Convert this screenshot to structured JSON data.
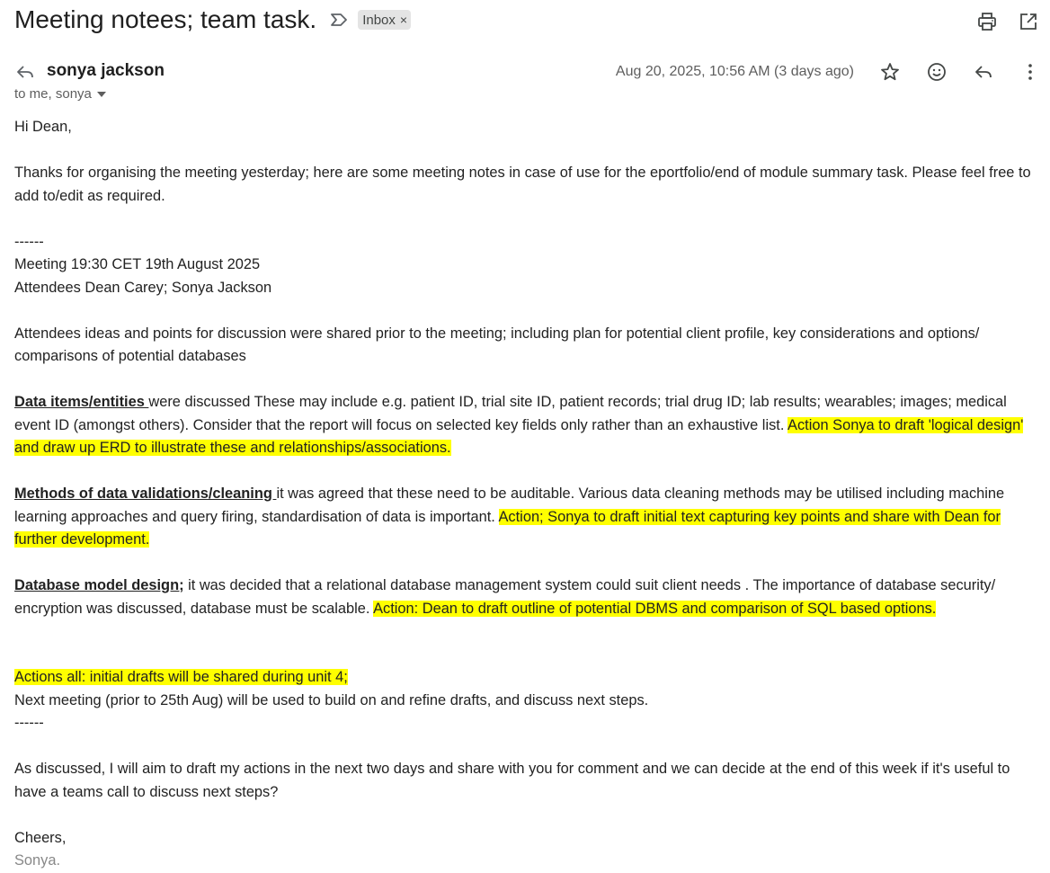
{
  "header": {
    "subject": "Meeting notees; team task.",
    "label": "Inbox",
    "label_close": "×"
  },
  "sender": {
    "name": "sonya jackson",
    "recipients": "to me, sonya",
    "date": "Aug 20, 2025, 10:56 AM (3 days ago)"
  },
  "icons": {
    "important": "important-marker-icon",
    "print": "print-icon",
    "open_new_window": "open-in-new-window-icon",
    "star": "star-icon",
    "emoji": "emoji-react-icon",
    "reply": "reply-icon",
    "more": "more-vert-icon"
  },
  "email": {
    "greeting": "Hi Dean,",
    "intro": "Thanks for organising the meeting yesterday; here are some meeting notes in case of use for the eportfolio/end of module summary task.  Please feel free to add to/edit as required.",
    "separator1": "------",
    "meeting_line": "Meeting 19:30 CET 19th August 2025",
    "attendees_line": "Attendees Dean Carey; Sonya Jackson",
    "prior_ideas": "Attendees ideas and points for discussion were shared prior to the meeting; including plan for potential client profile, key considerations and options/ comparisons of potential databases",
    "section1": {
      "heading": "Data items/entities ",
      "text": "were discussed  These may include e.g. patient ID, trial site ID, patient records; trial drug ID; lab results; wearables; images; medical event ID (amongst others).  Consider that the report will focus on selected key fields only rather than an exhaustive list. ",
      "action": "Action Sonya to draft 'logical design' and draw up ERD to illustrate these and relationships/associations.  "
    },
    "section2": {
      "heading": "Methods of data validations/cleaning ",
      "text": " it was agreed that these need to be auditable.  Various data cleaning methods may be utilised including machine learning approaches and query firing, standardisation of data is important. ",
      "action": "Action; Sonya to draft initial text capturing key points and share with Dean for further development."
    },
    "section3": {
      "heading": "Database model design;",
      "text": " it was decided that  a relational database management system could suit client needs .  The importance of database security/ encryption was discussed, database must be scalable. ",
      "action": " Action: Dean to draft outline of potential DBMS and comparison of SQL based options."
    },
    "actions_all": "Actions all: initial drafts will be shared during unit 4; ",
    "next_meeting": "Next meeting (prior to 25th Aug) will be used to build on and refine drafts, and discuss next steps.",
    "separator2": "------",
    "closing": "As discussed, I will aim to draft my actions in the next two days and share with you for comment and we can decide at the end of this week if it's useful to have a teams call to discuss next steps?",
    "cheers": "Cheers,",
    "signature": "Sonya."
  }
}
